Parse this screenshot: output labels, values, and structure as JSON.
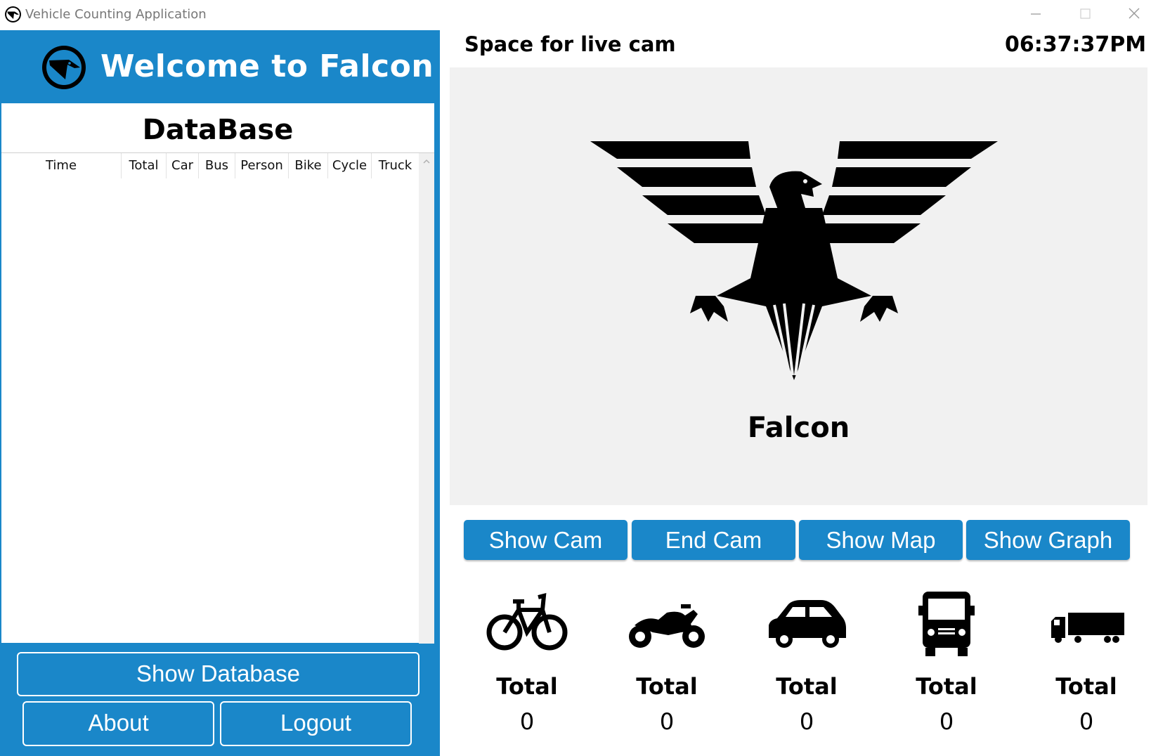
{
  "window": {
    "title": "Vehicle Counting Application",
    "app_icon": "falcon-logo-icon",
    "controls": [
      "minimize-icon",
      "maximize-icon",
      "close-icon"
    ]
  },
  "sidebar": {
    "welcome": "Welcome to Falcon",
    "logo_icon": "falcon-logo-icon",
    "database_title": "DataBase",
    "columns": [
      "Time",
      "Total",
      "Car",
      "Bus",
      "Person",
      "Bike",
      "Cycle",
      "Truck"
    ],
    "rows": [],
    "buttons": {
      "show_database": "Show Database",
      "about": "About",
      "logout": "Logout"
    }
  },
  "main": {
    "cam_title": "Space for live cam",
    "clock": "06:37:37PM",
    "brand": "Falcon",
    "buttons": {
      "show_cam": "Show Cam",
      "end_cam": "End Cam",
      "show_map": "Show Map",
      "show_graph": "Show Graph"
    },
    "counters": [
      {
        "icon": "bicycle-icon",
        "label": "Total",
        "value": "0"
      },
      {
        "icon": "motorcycle-icon",
        "label": "Total",
        "value": "0"
      },
      {
        "icon": "car-icon",
        "label": "Total",
        "value": "0"
      },
      {
        "icon": "bus-icon",
        "label": "Total",
        "value": "0"
      },
      {
        "icon": "truck-icon",
        "label": "Total",
        "value": "0"
      }
    ]
  },
  "colors": {
    "accent": "#1a87c9",
    "cam_background": "#f1f1f1"
  }
}
